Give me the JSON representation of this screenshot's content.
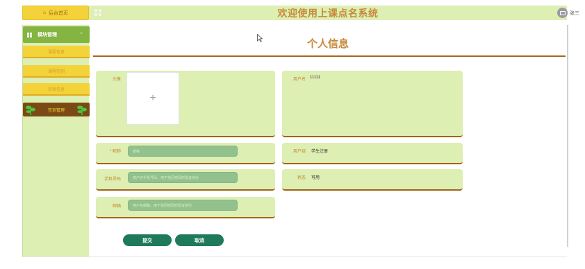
{
  "header": {
    "home_tab_label": "后台首页",
    "title": "欢迎使用上课点名系统",
    "username": "张三"
  },
  "sidebar": {
    "module_label": "模块管理",
    "items": [
      {
        "label": "课程信息"
      },
      {
        "label": "课程签到"
      },
      {
        "label": "实验信息"
      },
      {
        "label": "签到管理"
      }
    ]
  },
  "main": {
    "page_title": "个人信息",
    "avatar_label": "头像",
    "upload_plus": "+",
    "username_label": "用户名",
    "username_value": "11111",
    "nickname_label": "* 昵称",
    "nickname_placeholder": "昵称",
    "usergroup_label": "用户组",
    "usergroup_value": "学生注册",
    "phone_label": "手机号码",
    "phone_placeholder": "用户名手机号码，用于找回密码时验证身份",
    "status_label": "状态",
    "status_value": "可用",
    "email_label": "邮箱",
    "email_placeholder": "用户名邮箱，用于找回密码时验证身份",
    "submit_label": "提交",
    "cancel_label": "取消"
  },
  "colors": {
    "accent": "#c6893b",
    "card_bg": "#ddefb2",
    "card_border": "#a36418",
    "button": "#1e7a5b",
    "menu_header": "#84b441",
    "menu_item": "#f3d23a",
    "menu_active": "#7b4a14"
  },
  "icons": {
    "home": "home-icon",
    "grid": "grid-icon",
    "avatar": "user-avatar-icon",
    "plant": "plant-icon",
    "cursor": "mouse-pointer-icon"
  }
}
